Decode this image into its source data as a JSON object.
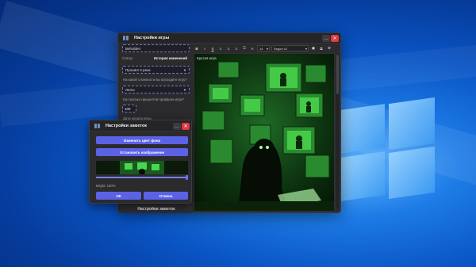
{
  "main_window": {
    "title": "Настройки игры",
    "game_name": "Beholden",
    "status_label": "Статус",
    "history_button": "История изменений",
    "status_value": "Прошёл 3 раза",
    "difficulty_question": "На какой сложности вы проходите игру?",
    "difficulty_value": "Легко",
    "percent_question": "На сколько процентов пройдена игра?",
    "percent_value": "100",
    "start_date_label": "Дата начала игры",
    "notes_settings_button": "Настройки заметок"
  },
  "editor": {
    "font_size": "14",
    "font_name": "Segoe UI",
    "text": "Крутая игра",
    "tools": [
      "bold",
      "italic",
      "underline",
      "align-left",
      "align-center",
      "align-right",
      "list",
      "text-color",
      "image",
      "copy",
      "settings"
    ]
  },
  "notes_dialog": {
    "title": "Настройки заметок",
    "change_bg_button": "Изменить цвет фона",
    "set_image_button": "Установить изображение",
    "bright_label": "Bright: 100%",
    "bright_level": 1.0,
    "ok_button": "ОК",
    "cancel_button": "Отмена"
  },
  "colors": {
    "accent": "#5b62e6",
    "close": "#e0393e",
    "art_green": "#3fd24a"
  }
}
